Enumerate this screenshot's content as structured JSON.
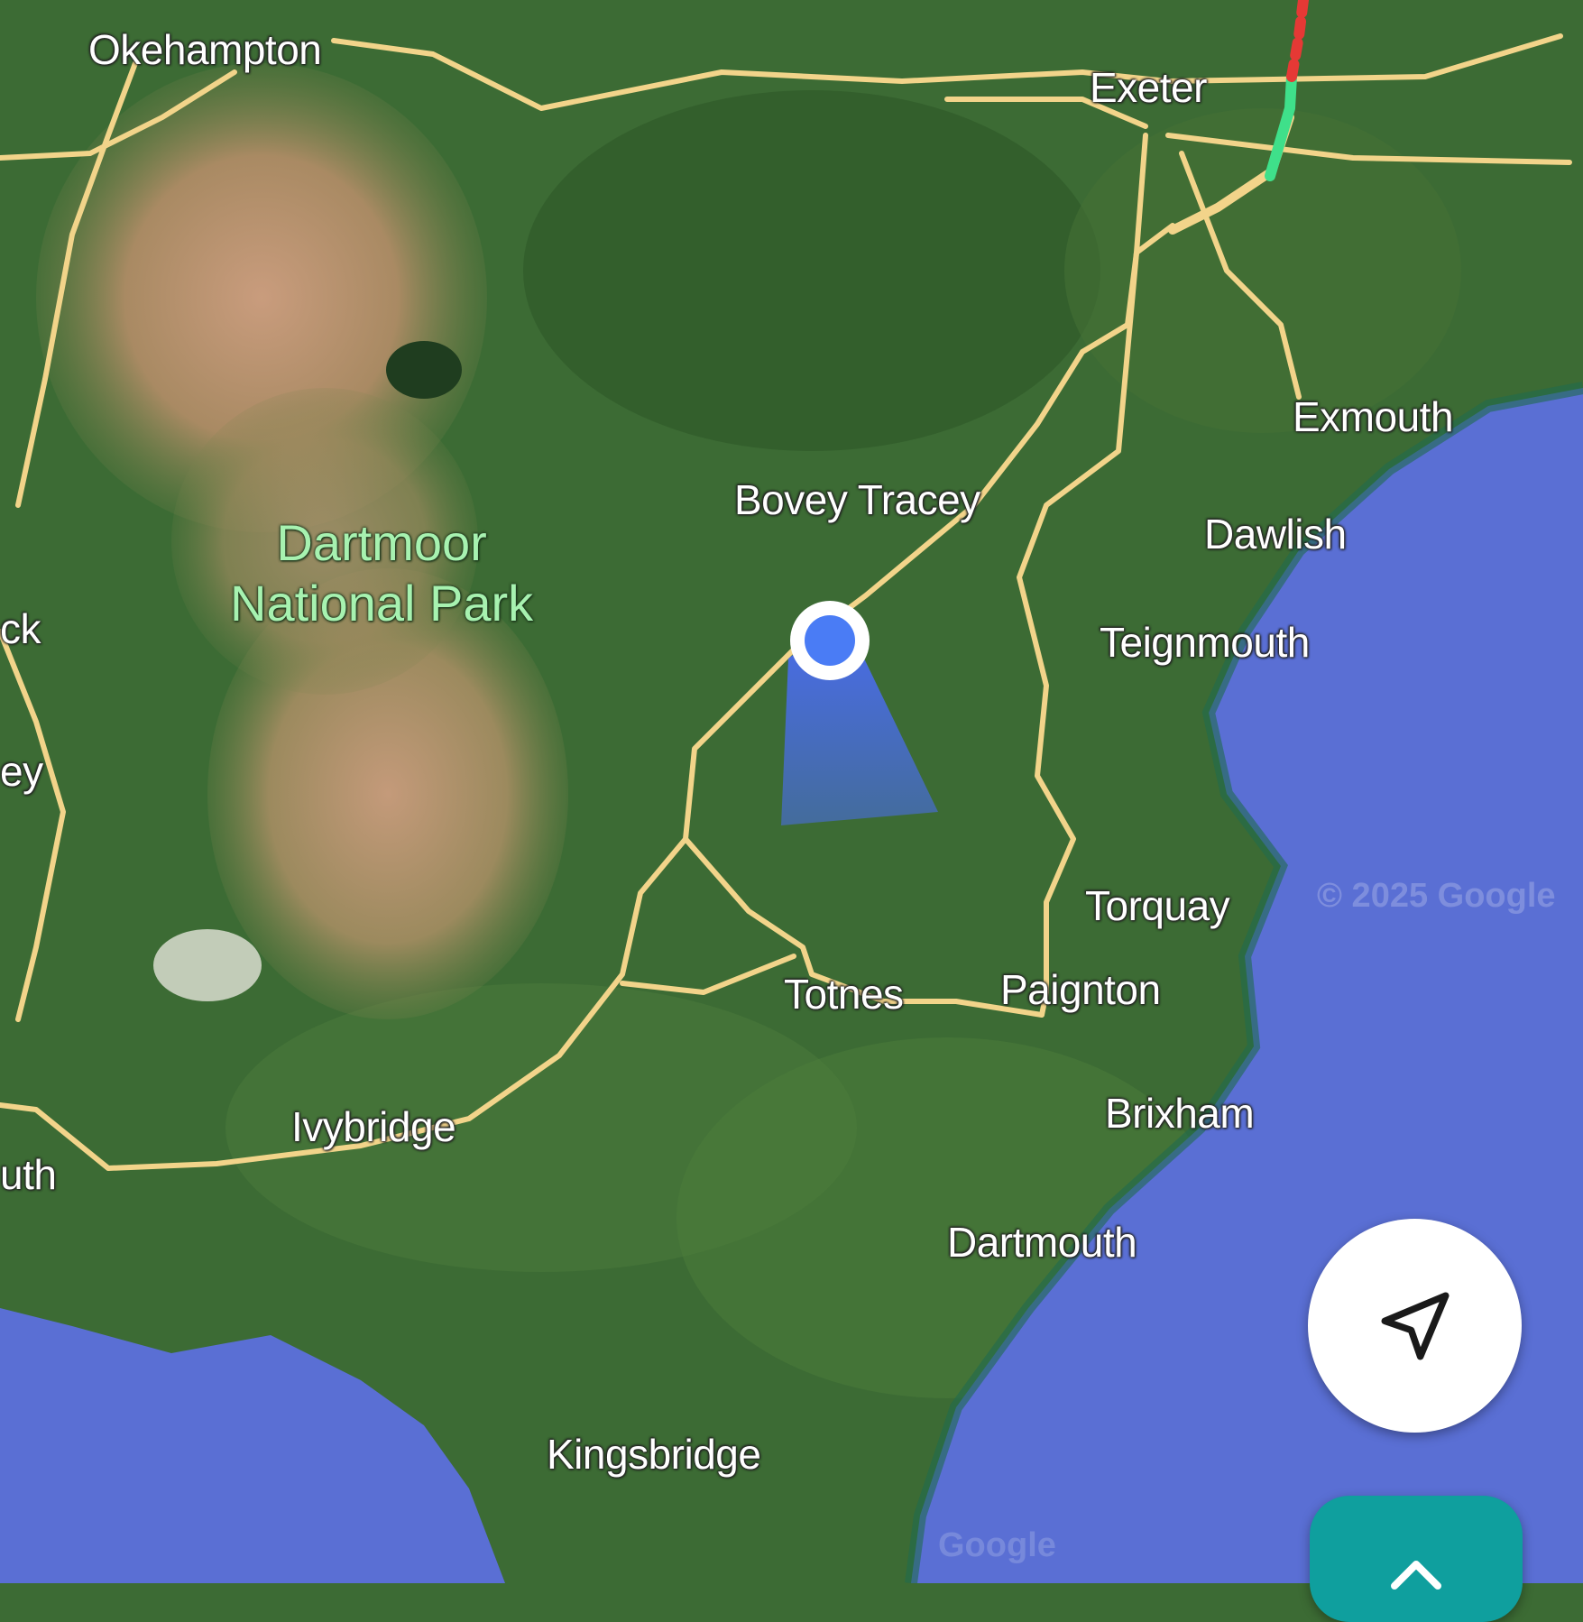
{
  "map": {
    "style": "satellite",
    "colors": {
      "land": "#3c6b34",
      "moorland": "#b78f70",
      "sea": "#5a6fd4",
      "road": "#f2d48a",
      "location_dot": "#4a7cf5",
      "heading_cone": "#4a6cf0",
      "traffic_clear": "#3fe08a",
      "traffic_heavy": "#e53935"
    },
    "place_labels": {
      "okehampton": "Okehampton",
      "exeter": "Exeter",
      "exmouth": "Exmouth",
      "bovey_tracey": "Bovey Tracey",
      "dawlish": "Dawlish",
      "teignmouth": "Teignmouth",
      "torquay": "Torquay",
      "totnes": "Totnes",
      "paignton": "Paignton",
      "brixham": "Brixham",
      "ivybridge": "Ivybridge",
      "dartmouth": "Dartmouth",
      "kingsbridge": "Kingsbridge",
      "partial_left_1": "ck",
      "partial_left_2": "ey",
      "partial_left_3": "uth"
    },
    "park": {
      "line1": "Dartmoor",
      "line2": "National Park"
    },
    "attribution": "© 2025 Google"
  },
  "controls": {
    "locate_icon": "navigation-arrow-icon",
    "directions_icon": "chevron-up-icon"
  }
}
